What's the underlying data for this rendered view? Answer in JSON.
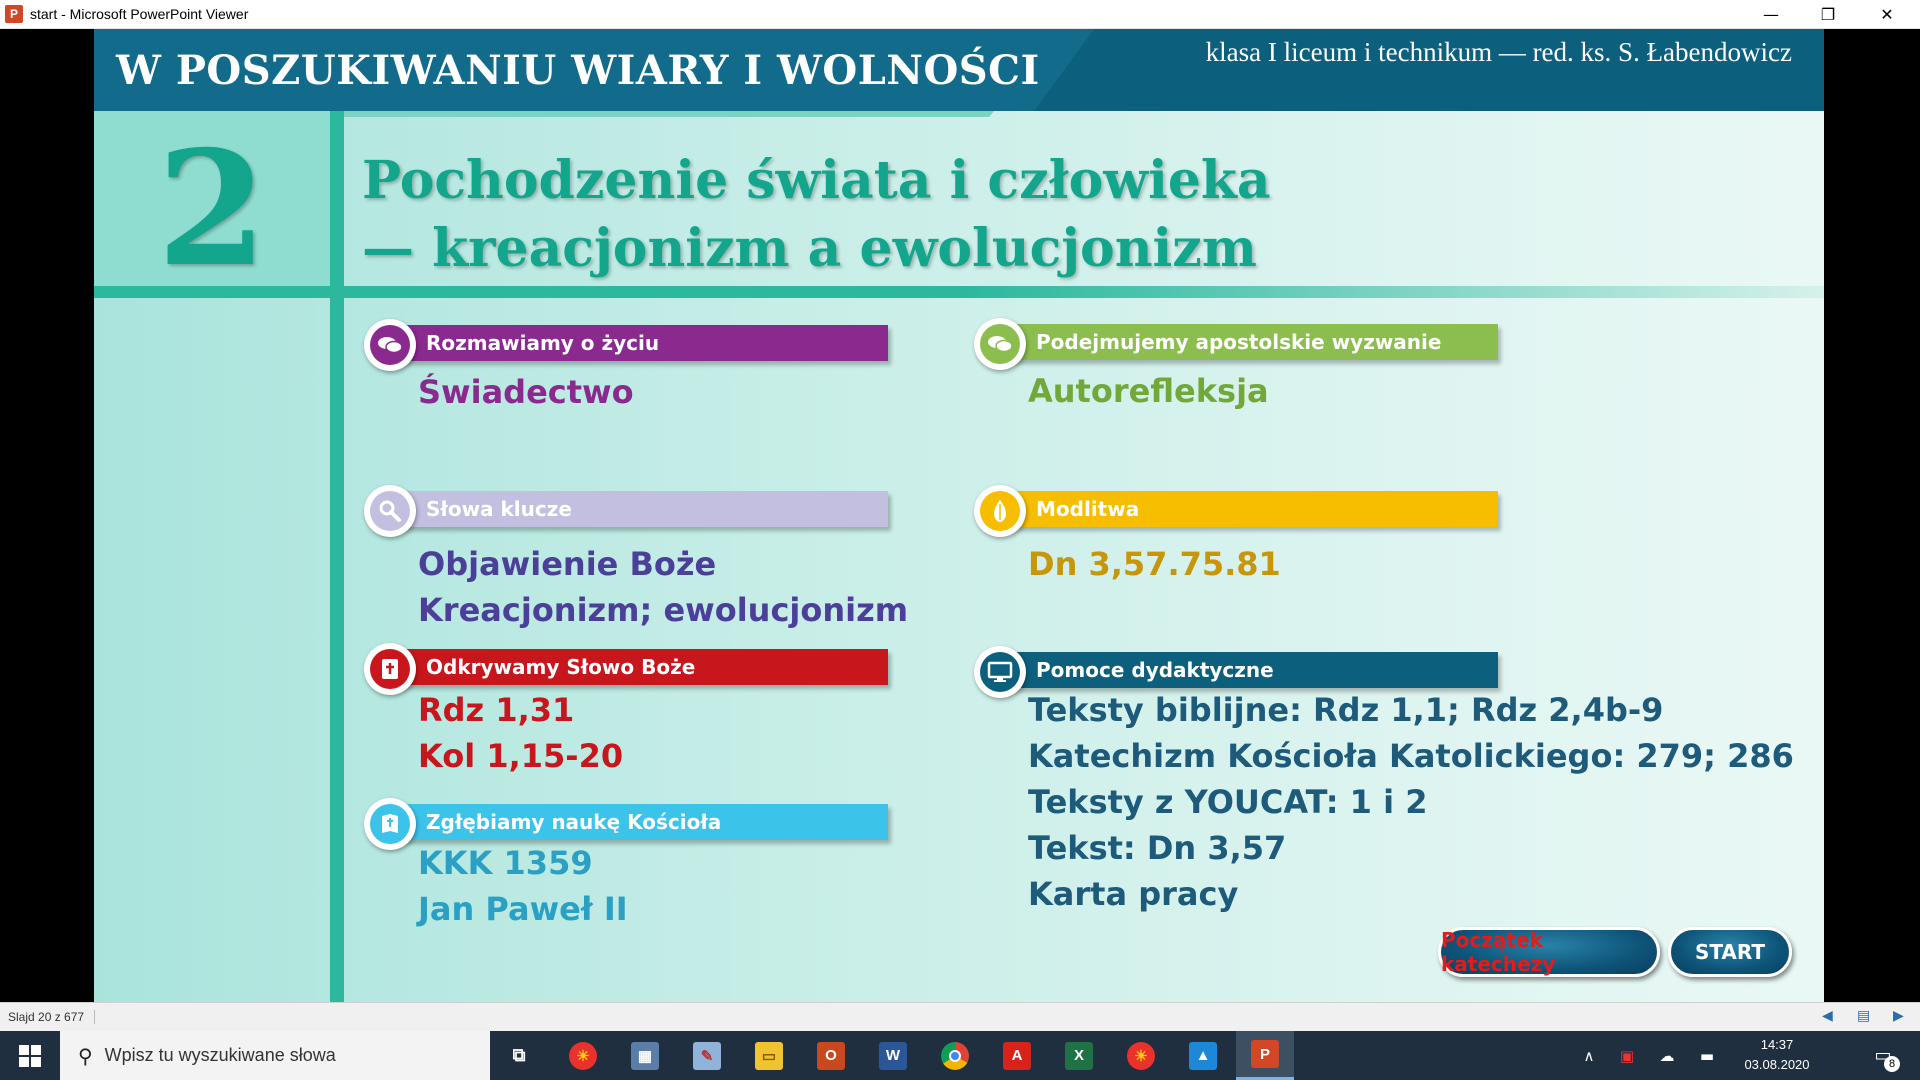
{
  "window": {
    "title": "start - Microsoft PowerPoint Viewer",
    "app_icon_letter": "P",
    "controls": {
      "minimize": "—",
      "restore": "❐",
      "close": "✕"
    }
  },
  "slide": {
    "series_title": "W POSZUKIWANIU WIARY I WOLNOŚCI",
    "subtitle": "klasa I liceum i technikum — red. ks. S. Łabendowicz",
    "chapter_number": "2",
    "lesson_title_line1": "Pochodzenie świata i człowieka",
    "lesson_title_line2": "— kreacjonizm a ewolucjonizm",
    "sections": {
      "rozmawiamy": {
        "label": "Rozmawiamy o życiu",
        "color": "#8b2a8e",
        "icon": "speech-bubbles-icon",
        "items": [
          "Świadectwo"
        ]
      },
      "slowa": {
        "label": "Słowa klucze",
        "color": "#c3bfe0",
        "icon": "magnifier-icon",
        "items": [
          "Objawienie Boże",
          "Kreacjonizm; ewolucjonizm"
        ],
        "text_color": "#4b3f99"
      },
      "odkrywamy": {
        "label": "Odkrywamy Słowo Boże",
        "color": "#c8161d",
        "icon": "bible-icon",
        "items": [
          "Rdz 1,31",
          "Kol 1,15-20"
        ]
      },
      "zglebiamy": {
        "label": "Zgłębiamy naukę Kościoła",
        "color": "#3cc3ea",
        "icon": "book-cross-icon",
        "items": [
          "KKK 1359",
          "Jan Paweł II"
        ],
        "text_color": "#2aa0c4"
      },
      "podejmujemy": {
        "label": "Podejmujemy apostolskie wyzwanie",
        "color": "#8bbd4f",
        "icon": "chat-bubbles-icon",
        "items": [
          "Autorefleksja"
        ],
        "text_color": "#72a83a"
      },
      "modlitwa": {
        "label": "Modlitwa",
        "color": "#f7be00",
        "icon": "praying-hands-icon",
        "items": [
          "Dn 3,57.75.81"
        ],
        "text_color": "#c8960a"
      },
      "pomoce": {
        "label": "Pomoce dydaktyczne",
        "color": "#0d5f7e",
        "icon": "computer-icon",
        "items": [
          "Teksty biblijne: Rdz 1,1; Rdz 2,4b-9",
          "Katechizm Kościoła Katolickiego: 279; 286",
          "Teksty z YOUCAT: 1 i 2",
          "Tekst: Dn 3,57",
          "Karta pracy"
        ],
        "text_color": "#1e5a7a"
      }
    },
    "buttons": {
      "poczatek": {
        "label": "Początek katechezy",
        "text_color": "#e01c1c"
      },
      "start": {
        "label": "START",
        "text_color": "#ffffff"
      }
    }
  },
  "statusbar": {
    "slide_counter": "Slajd 20 z 677"
  },
  "taskbar": {
    "search_placeholder": "Wpisz tu wyszukiwane słowa",
    "clock_time": "14:37",
    "clock_date": "03.08.2020",
    "notification_count": "8"
  }
}
